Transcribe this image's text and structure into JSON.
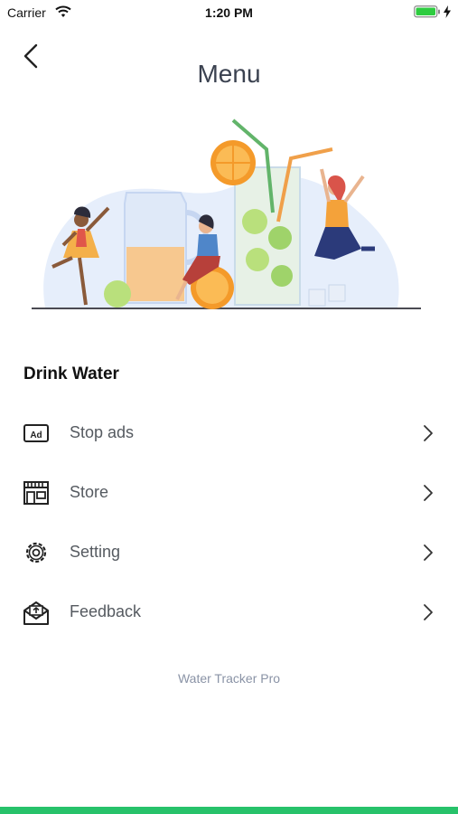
{
  "status_bar": {
    "carrier": "Carrier",
    "time": "1:20 PM",
    "battery_icon": "battery-full-icon",
    "battery_color": "#2ecc40"
  },
  "header": {
    "title": "Menu",
    "back_icon": "chevron-left-icon"
  },
  "hero": {
    "illustration": "people-with-drinks-illustration"
  },
  "section": {
    "title": "Drink Water"
  },
  "menu": {
    "items": [
      {
        "label": "Stop ads",
        "icon": "ad-icon"
      },
      {
        "label": "Store",
        "icon": "store-icon"
      },
      {
        "label": "Setting",
        "icon": "gear-icon"
      },
      {
        "label": "Feedback",
        "icon": "mail-icon"
      }
    ]
  },
  "footer": {
    "text": "Water Tracker Pro"
  },
  "colors": {
    "accent": "#27c26a",
    "title": "#3b4250",
    "footer": "#8a93a6"
  }
}
